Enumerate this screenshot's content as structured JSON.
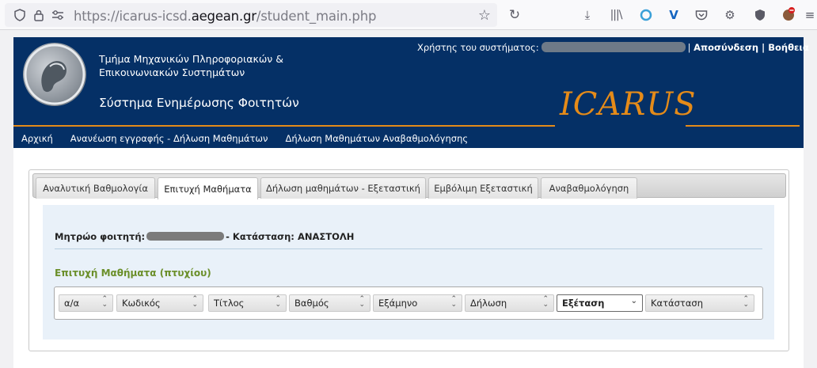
{
  "browser": {
    "url_prefix": "https://icarus-icsd.",
    "url_domain": "aegean.gr",
    "url_path": "/student_main.php"
  },
  "header": {
    "dept_line1": "Τμήμα Μηχανικών Πληροφοριακών &",
    "dept_line2": "Επικοινωνιακών Συστημάτων",
    "system_title": "Σύστημα Ενημέρωσης Φοιτητών",
    "user_label": "Χρήστης του συστήματος:",
    "logout": "Αποσύνδεση",
    "separator": "|",
    "help": "Βοήθεια",
    "brand": "ICARUS"
  },
  "nav": {
    "items": [
      "Αρχική",
      "Ανανέωση εγγραφής - Δήλωση Μαθημάτων",
      "Δήλωση Μαθημάτων Αναβαθμολόγησης"
    ]
  },
  "tabs": {
    "items": [
      "Αναλυτική Βαθμολογία",
      "Επιτυχή Μαθήματα",
      "Δήλωση μαθημάτων - Εξεταστική",
      "Εμβόλιμη Εξεταστική",
      "Αναβαθμολόγηση"
    ],
    "active": "Επιτυχή Μαθήματα"
  },
  "student": {
    "reg_label": "Μητρώο φοιτητή:",
    "status_label": "- Κατάσταση:",
    "status_value": "ΑΝΑΣΤΟΛΗ"
  },
  "section": {
    "title": "Επιτυχή Μαθήματα (πτυχίου)"
  },
  "grid": {
    "columns": [
      "α/α",
      "Κωδικός",
      "Τίτλος",
      "Βαθμός",
      "Εξάμηνο",
      "Δήλωση",
      "Εξέταση",
      "Κατάσταση"
    ],
    "selected": "Εξέταση"
  },
  "colors": {
    "header_bg": "#053066",
    "accent": "#e58b19",
    "section_title": "#6b8f2a"
  }
}
